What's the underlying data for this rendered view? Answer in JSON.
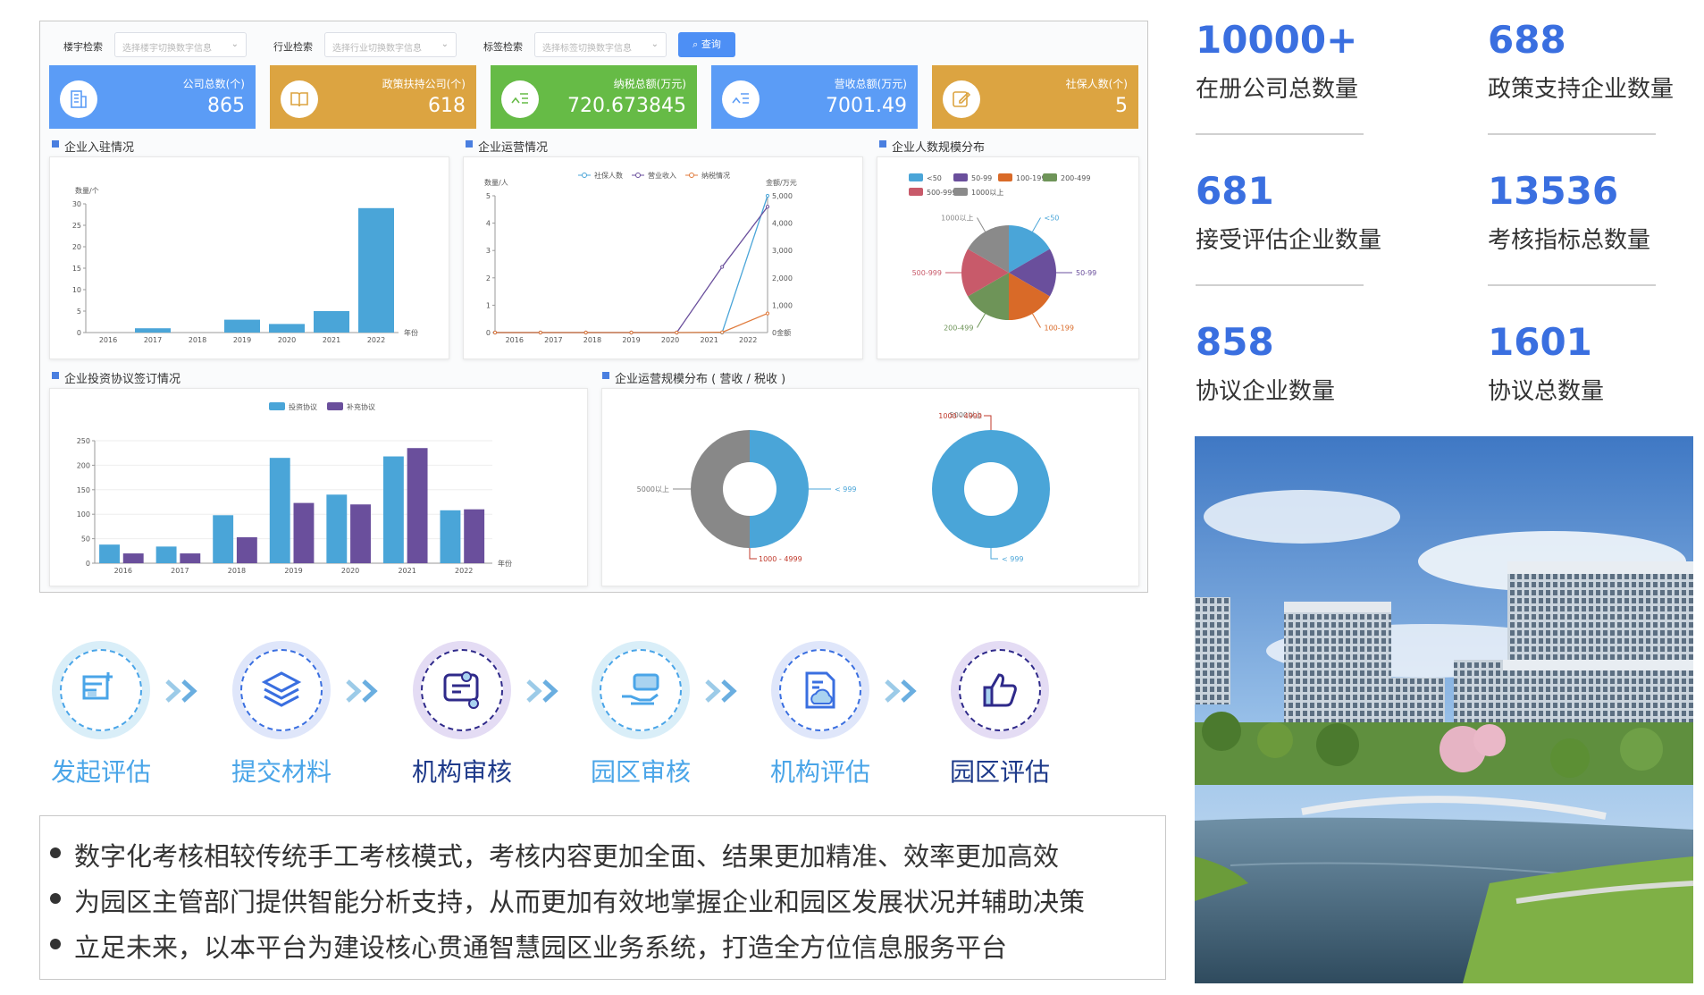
{
  "search": {
    "fields": [
      {
        "label": "楼宇检索",
        "placeholder": "选择楼宇切换数字信息"
      },
      {
        "label": "行业检索",
        "placeholder": "选择行业切换数字信息"
      },
      {
        "label": "标签检索",
        "placeholder": "选择标签切换数字信息"
      }
    ],
    "button": "查询"
  },
  "kpis": [
    {
      "label": "公司总数(个)",
      "value": "865",
      "color": "#5b9cf6",
      "icon": "building-icon"
    },
    {
      "label": "政策扶持公司(个)",
      "value": "618",
      "color": "#dca441",
      "icon": "book-icon"
    },
    {
      "label": "纳税总额(万元)",
      "value": "720.673845",
      "color": "#66bb46",
      "icon": "chart-check-icon"
    },
    {
      "label": "营收总额(万元)",
      "value": "7001.49",
      "color": "#5b9cf6",
      "icon": "chart-check-icon"
    },
    {
      "label": "社保人数(个)",
      "value": "5",
      "color": "#dca441",
      "icon": "edit-icon"
    }
  ],
  "panels": {
    "settle": "企业入驻情况",
    "ops": "企业运营情况",
    "staff": "企业人数规模分布",
    "invest": "企业投资协议签订情况",
    "scale": "企业运营规模分布 ( 营收 / 税收 )"
  },
  "chart_data": [
    {
      "type": "bar",
      "title": "企业入驻情况",
      "ylabel": "数量/个",
      "xlabel": "年份",
      "categories": [
        "2016",
        "2017",
        "2018",
        "2019",
        "2020",
        "2021",
        "2022"
      ],
      "values": [
        0,
        1,
        0,
        3,
        2,
        5,
        29
      ],
      "ylim": [
        0,
        30
      ],
      "yticks": [
        "0",
        "5",
        "10",
        "15",
        "20",
        "25",
        "30"
      ],
      "color": "#4aa5d8"
    },
    {
      "type": "line",
      "title": "企业运营情况",
      "ylabel": "数量/人",
      "y2label": "金额/万元",
      "categories": [
        "2016",
        "2017",
        "2018",
        "2019",
        "2020",
        "2021",
        "2022"
      ],
      "ylim": [
        0,
        5
      ],
      "y2lim": [
        0,
        5000
      ],
      "yticks": [
        "0",
        "1",
        "2",
        "3",
        "4",
        "5"
      ],
      "y2ticks": [
        "0金额",
        "1,000",
        "2,000",
        "3,000",
        "4,000",
        "5,000"
      ],
      "series": [
        {
          "name": "社保人数",
          "axis": "left",
          "values": [
            0,
            0,
            0,
            0,
            0,
            0,
            5
          ],
          "color": "#4aa5d8"
        },
        {
          "name": "营业收入",
          "axis": "right",
          "values": [
            0,
            0,
            0,
            0,
            0,
            2400,
            4600
          ],
          "color": "#6a4f9c"
        },
        {
          "name": "纳税情况",
          "axis": "right",
          "values": [
            0,
            0,
            0,
            0,
            0,
            10,
            700
          ],
          "color": "#e07a3b"
        }
      ]
    },
    {
      "type": "pie",
      "title": "企业人数规模分布",
      "legend": [
        {
          "name": "<50",
          "color": "#4aa5d8"
        },
        {
          "name": "50-99",
          "color": "#6a4f9c"
        },
        {
          "name": "100-199",
          "color": "#d96a28"
        },
        {
          "name": "200-499",
          "color": "#6e9458"
        },
        {
          "name": "500-999",
          "color": "#c85a6a"
        },
        {
          "name": "1000以上",
          "color": "#8a8a8a"
        }
      ],
      "values": [
        1,
        1,
        1,
        1,
        1,
        1
      ]
    },
    {
      "type": "bar",
      "title": "企业投资协议签订情况",
      "xlabel": "年份",
      "categories": [
        "2016",
        "2017",
        "2018",
        "2019",
        "2020",
        "2021",
        "2022"
      ],
      "ylim": [
        0,
        250
      ],
      "yticks": [
        "0",
        "50",
        "100",
        "150",
        "200",
        "250"
      ],
      "series": [
        {
          "name": "投资协议",
          "values": [
            38,
            34,
            98,
            215,
            140,
            218,
            108
          ],
          "color": "#4aa5d8"
        },
        {
          "name": "补充协议",
          "values": [
            20,
            20,
            53,
            123,
            120,
            235,
            110
          ],
          "color": "#6a4f9c"
        }
      ]
    },
    {
      "type": "pie",
      "title": "营收",
      "values": [
        {
          "name": "< 999",
          "value": 50,
          "color": "#4aa5d8"
        },
        {
          "name": "5000以上",
          "value": 50,
          "color": "#888888"
        },
        {
          "name": "1000 - 4999",
          "value": 0,
          "color": "#c0392b"
        }
      ]
    },
    {
      "type": "pie",
      "title": "税收",
      "values": [
        {
          "name": "< 999",
          "value": 100,
          "color": "#4aa5d8"
        },
        {
          "name": "5000以上",
          "value": 0,
          "color": "#888888"
        },
        {
          "name": "1000 - 4999",
          "value": 0,
          "color": "#c0392b"
        }
      ]
    }
  ],
  "process": [
    {
      "label": "发起评估",
      "color": "#4aa5e8",
      "ring": "#d9eef8",
      "dash": "#4aa5e8",
      "icon": "form-add-icon"
    },
    {
      "label": "提交材料",
      "color": "#4aa5e8",
      "ring": "#dfe6fa",
      "dash": "#3a6fe0",
      "icon": "layers-icon"
    },
    {
      "label": "机构审核",
      "color": "#1e3a8a",
      "ring": "#e4dcf4",
      "dash": "#2f2a8a",
      "icon": "review-icon"
    },
    {
      "label": "园区审核",
      "color": "#4aa5e8",
      "ring": "#d9eef8",
      "dash": "#4aa5e8",
      "icon": "hand-card-icon"
    },
    {
      "label": "机构评估",
      "color": "#4aa5e8",
      "ring": "#dfe6fa",
      "dash": "#3a6fe0",
      "icon": "document-cloud-icon"
    },
    {
      "label": "园区评估",
      "color": "#1e3a8a",
      "ring": "#e4dcf4",
      "dash": "#2f2a8a",
      "icon": "thumbs-up-icon"
    }
  ],
  "description": [
    "数字化考核相较传统手工考核模式，考核内容更加全面、结果更加精准、效率更加高效",
    "为园区主管部门提供智能分析支持，从而更加有效地掌握企业和园区发展状况并辅助决策",
    "立足未来，以本平台为建设核心贯通智慧园区业务系统，打造全方位信息服务平台"
  ],
  "stats": [
    {
      "num": "10000+",
      "label": "在册公司总数量"
    },
    {
      "num": "688",
      "label": "政策支持企业数量"
    },
    {
      "num": "681",
      "label": "接受评估企业数量"
    },
    {
      "num": "13536",
      "label": "考核指标总数量"
    },
    {
      "num": "858",
      "label": "协议企业数量"
    },
    {
      "num": "1601",
      "label": "协议总数量"
    }
  ]
}
